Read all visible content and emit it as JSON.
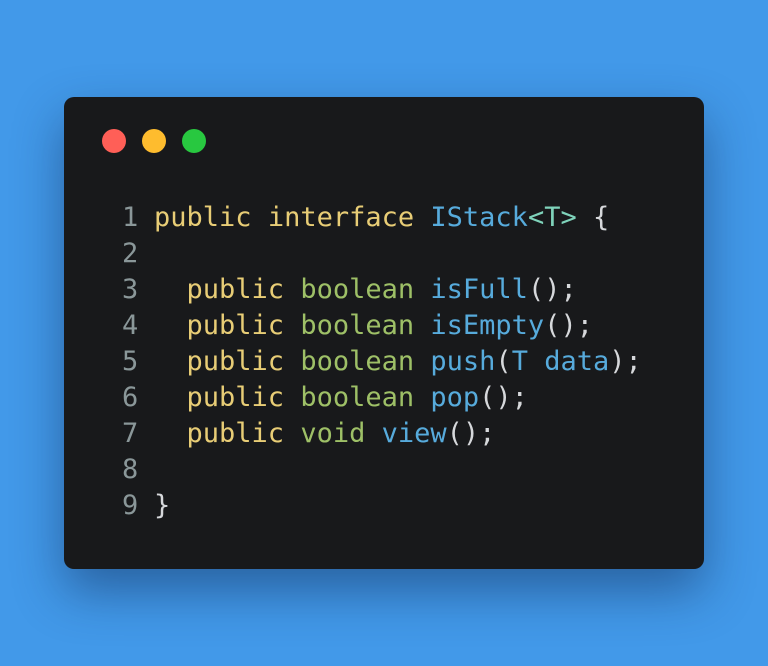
{
  "window": {
    "dots": [
      {
        "name": "close-dot",
        "color": "#ff5f57"
      },
      {
        "name": "minimize-dot",
        "color": "#febc2e"
      },
      {
        "name": "maximize-dot",
        "color": "#28c840"
      }
    ]
  },
  "code": {
    "lines": [
      {
        "num": "1",
        "tokens": [
          {
            "t": "public",
            "c": "kw"
          },
          {
            "t": " ",
            "c": "pn"
          },
          {
            "t": "interface",
            "c": "kw"
          },
          {
            "t": " ",
            "c": "pn"
          },
          {
            "t": "IStack",
            "c": "fn"
          },
          {
            "t": "<T>",
            "c": "gen"
          },
          {
            "t": " {",
            "c": "pn"
          }
        ]
      },
      {
        "num": "2",
        "tokens": []
      },
      {
        "num": "3",
        "tokens": [
          {
            "t": "  ",
            "c": "pn"
          },
          {
            "t": "public",
            "c": "kw"
          },
          {
            "t": " ",
            "c": "pn"
          },
          {
            "t": "boolean",
            "c": "ty"
          },
          {
            "t": " ",
            "c": "pn"
          },
          {
            "t": "isFull",
            "c": "fn"
          },
          {
            "t": "();",
            "c": "pn"
          }
        ]
      },
      {
        "num": "4",
        "tokens": [
          {
            "t": "  ",
            "c": "pn"
          },
          {
            "t": "public",
            "c": "kw"
          },
          {
            "t": " ",
            "c": "pn"
          },
          {
            "t": "boolean",
            "c": "ty"
          },
          {
            "t": " ",
            "c": "pn"
          },
          {
            "t": "isEmpty",
            "c": "fn"
          },
          {
            "t": "();",
            "c": "pn"
          }
        ]
      },
      {
        "num": "5",
        "tokens": [
          {
            "t": "  ",
            "c": "pn"
          },
          {
            "t": "public",
            "c": "kw"
          },
          {
            "t": " ",
            "c": "pn"
          },
          {
            "t": "boolean",
            "c": "ty"
          },
          {
            "t": " ",
            "c": "pn"
          },
          {
            "t": "push",
            "c": "fn"
          },
          {
            "t": "(",
            "c": "pn"
          },
          {
            "t": "T data",
            "c": "fn"
          },
          {
            "t": ");",
            "c": "pn"
          }
        ]
      },
      {
        "num": "6",
        "tokens": [
          {
            "t": "  ",
            "c": "pn"
          },
          {
            "t": "public",
            "c": "kw"
          },
          {
            "t": " ",
            "c": "pn"
          },
          {
            "t": "boolean",
            "c": "ty"
          },
          {
            "t": " ",
            "c": "pn"
          },
          {
            "t": "pop",
            "c": "fn"
          },
          {
            "t": "();",
            "c": "pn"
          }
        ]
      },
      {
        "num": "7",
        "tokens": [
          {
            "t": "  ",
            "c": "pn"
          },
          {
            "t": "public",
            "c": "kw"
          },
          {
            "t": " ",
            "c": "pn"
          },
          {
            "t": "void",
            "c": "ty"
          },
          {
            "t": " ",
            "c": "pn"
          },
          {
            "t": "view",
            "c": "fn"
          },
          {
            "t": "();",
            "c": "pn"
          }
        ]
      },
      {
        "num": "8",
        "tokens": []
      },
      {
        "num": "9",
        "tokens": [
          {
            "t": "}",
            "c": "pn"
          }
        ]
      }
    ]
  }
}
